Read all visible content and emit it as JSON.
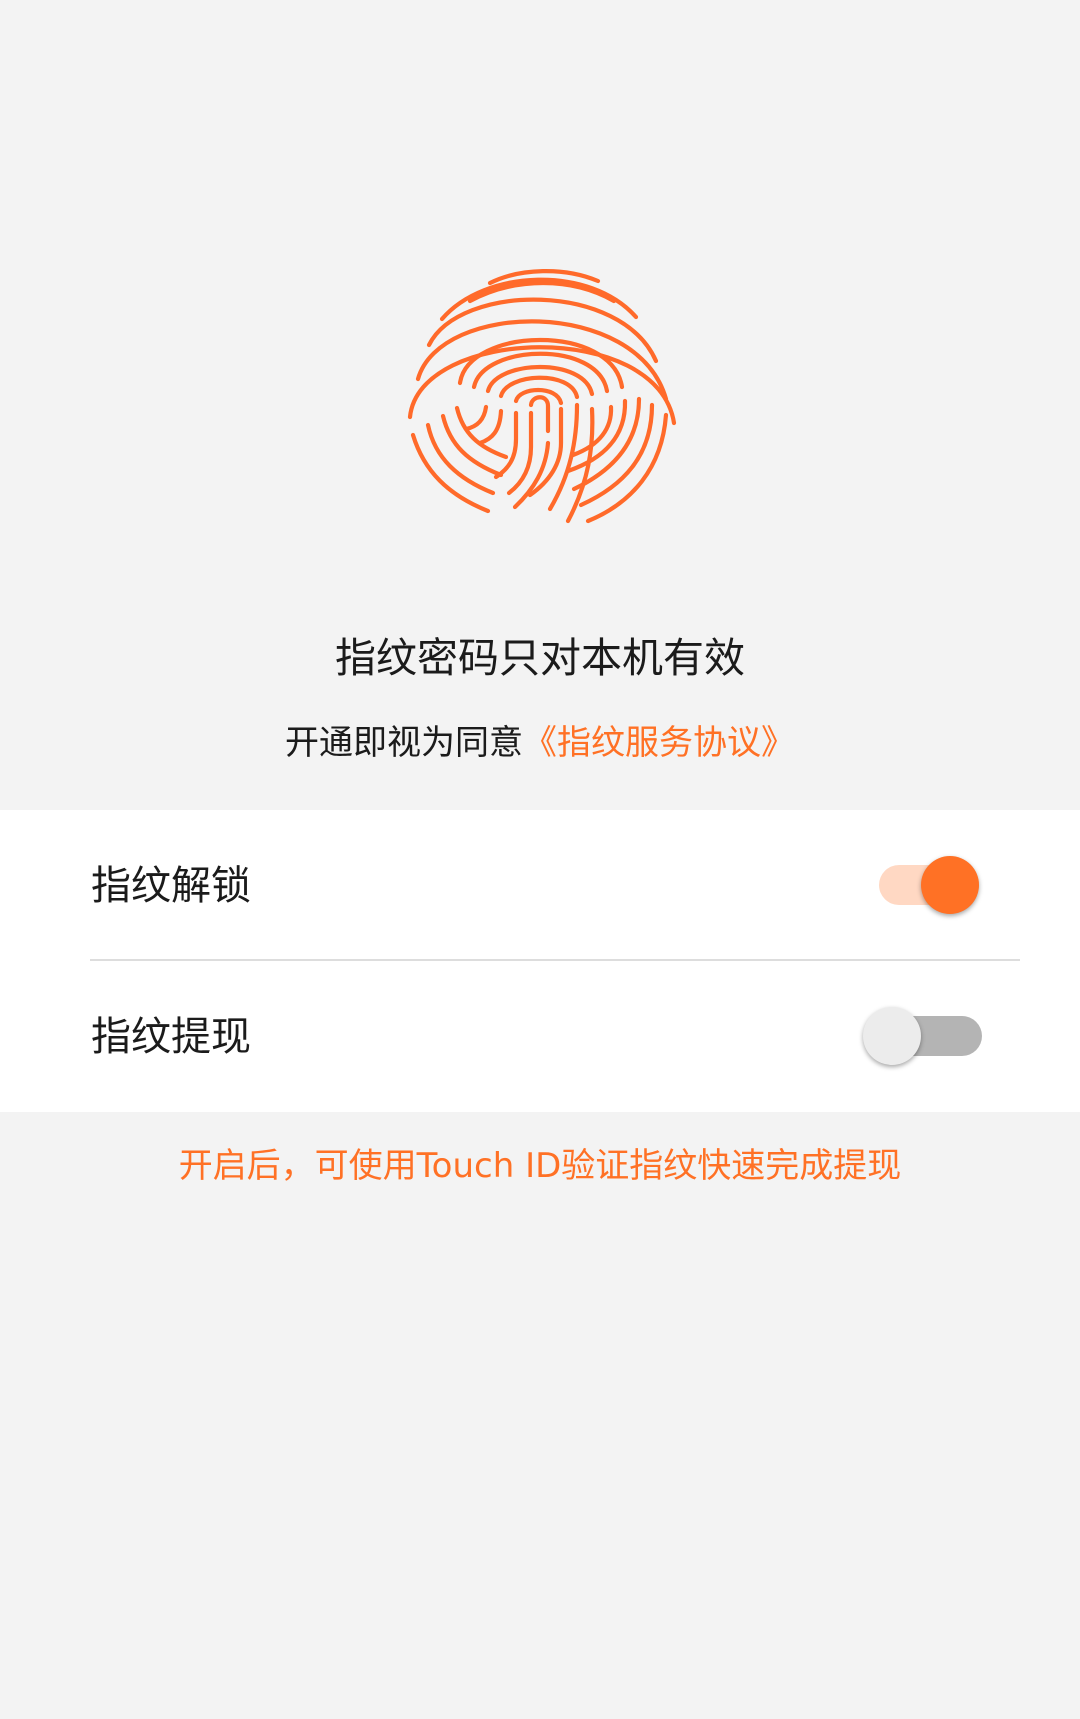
{
  "header": {
    "fingerprint_icon": "fingerprint-icon",
    "accent_color": "#ff7125"
  },
  "info": {
    "main_note": "指纹密码只对本机有效",
    "agree_prefix": "开通即视为同意",
    "agree_link": "《指纹服务协议》"
  },
  "settings": {
    "items": [
      {
        "label": "指纹解锁",
        "state": "on"
      },
      {
        "label": "指纹提现",
        "state": "off"
      }
    ]
  },
  "footer": {
    "hint": "开启后，可使用Touch ID验证指纹快速完成提现"
  }
}
